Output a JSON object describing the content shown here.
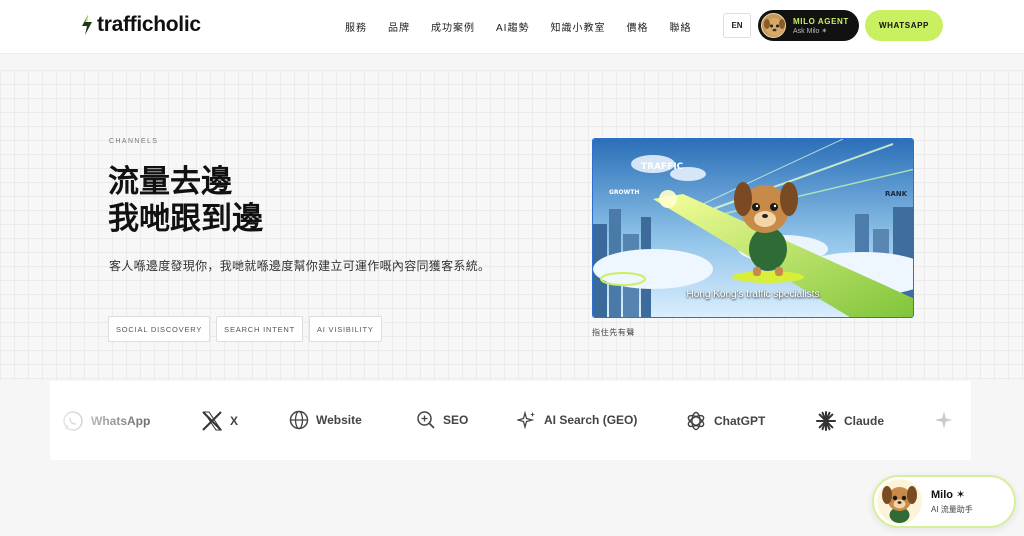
{
  "brand": {
    "name": "trafficholic",
    "accent": "#c8f060"
  },
  "nav": {
    "items": [
      "服務",
      "品牌",
      "成功案例",
      "AI趨勢",
      "知識小教室",
      "價格",
      "聯絡"
    ],
    "lang": "EN",
    "agent_title": "MILO AGENT",
    "agent_sub": "Ask Milo ✶",
    "whatsapp": "WHATSAPP"
  },
  "hero": {
    "eyebrow": "CHANNELS",
    "headline_1": "流量去邊",
    "headline_2": "我哋跟到邊",
    "subline": "客人喺邊度發現你，我哋就喺邊度幫你建立可運作嘅內容同獲客系統。",
    "tags": [
      "SOCIAL DISCOVERY",
      "SEARCH INTENT",
      "AI VISIBILITY"
    ]
  },
  "video": {
    "caption": "Hong Kong's traffic specialists",
    "sign_traffic": "TRAFFIC",
    "sign_growth": "GROWTH",
    "sign_rank": "RANK",
    "note": "指住先有聲"
  },
  "channels": [
    {
      "label": "WhatsApp",
      "icon": "whatsapp-icon"
    },
    {
      "label": "X",
      "icon": "x-logo-icon"
    },
    {
      "label": "Website",
      "icon": "globe-icon"
    },
    {
      "label": "SEO",
      "icon": "search-plus-icon"
    },
    {
      "label": "AI Search (GEO)",
      "icon": "sparkle-icon"
    },
    {
      "label": "ChatGPT",
      "icon": "chatgpt-icon"
    },
    {
      "label": "Claude",
      "icon": "claude-icon"
    }
  ],
  "milo": {
    "name": "Milo ✶",
    "sub": "AI 流量助手"
  }
}
